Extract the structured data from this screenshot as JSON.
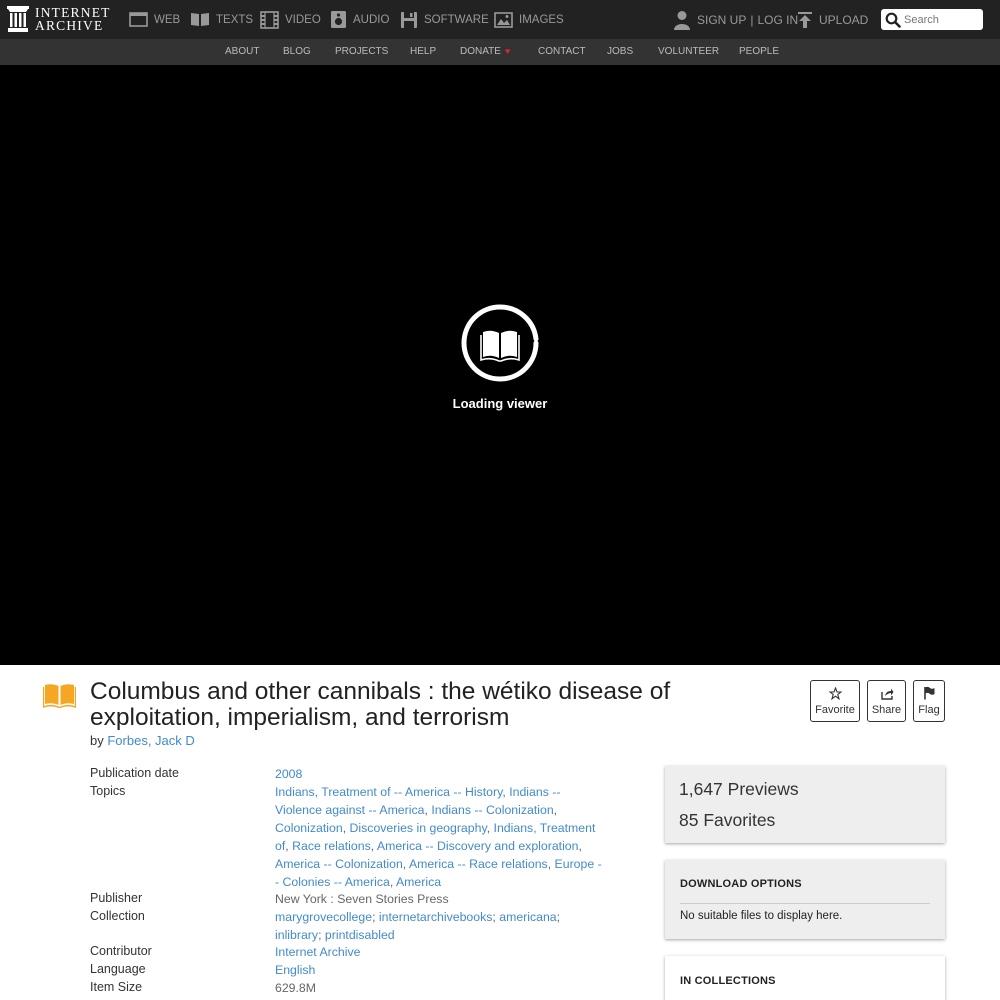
{
  "top_nav": {
    "logo_line1": "INTERNET",
    "logo_line2": "ARCHIVE",
    "items": [
      {
        "label": "WEB",
        "icon": "web-icon"
      },
      {
        "label": "TEXTS",
        "icon": "texts-icon"
      },
      {
        "label": "VIDEO",
        "icon": "video-icon"
      },
      {
        "label": "AUDIO",
        "icon": "audio-icon"
      },
      {
        "label": "SOFTWARE",
        "icon": "software-icon"
      },
      {
        "label": "IMAGES",
        "icon": "images-icon"
      }
    ],
    "sign_up": "SIGN UP",
    "separator": "|",
    "log_in": "LOG IN",
    "upload": "UPLOAD",
    "search_placeholder": "Search"
  },
  "sub_nav": {
    "items": [
      "ABOUT",
      "BLOG",
      "PROJECTS",
      "HELP",
      "DONATE",
      "CONTACT",
      "JOBS",
      "VOLUNTEER",
      "PEOPLE"
    ],
    "heart_icon": "♥"
  },
  "viewer": {
    "loading_text": "Loading viewer",
    "icon": "book-icon"
  },
  "item": {
    "title": "Columbus and other cannibals : the wétiko disease of exploitation, imperialism, and terrorism",
    "by_label": "by",
    "author": "Forbes, Jack D",
    "actions": {
      "favorite": "Favorite",
      "share": "Share",
      "flag": "Flag"
    }
  },
  "metadata": {
    "publication_date": {
      "label": "Publication date",
      "value": "2008"
    },
    "topics": {
      "label": "Topics",
      "values": [
        "Indians, Treatment of -- America -- History",
        "Indians -- Violence against -- America",
        "Indians -- Colonization",
        "Colonization",
        "Discoveries in geography",
        "Indians, Treatment of",
        "Race relations",
        "America -- Discovery and exploration",
        "America -- Colonization",
        "America -- Race relations",
        "Europe -- Colonies -- America",
        "America"
      ]
    },
    "publisher": {
      "label": "Publisher",
      "value": "New York : Seven Stories Press"
    },
    "collection": {
      "label": "Collection",
      "values": [
        "marygrovecollege",
        "internetarchivebooks",
        "americana",
        "inlibrary",
        "printdisabled"
      ]
    },
    "contributor": {
      "label": "Contributor",
      "value": "Internet Archive"
    },
    "language": {
      "label": "Language",
      "value": "English"
    },
    "item_size": {
      "label": "Item Size",
      "value": "629.8M"
    }
  },
  "stats": {
    "previews_count": "1,647",
    "previews_label": "Previews",
    "favorites_count": "85",
    "favorites_label": "Favorites"
  },
  "download": {
    "heading": "DOWNLOAD OPTIONS",
    "message": "No suitable files to display here."
  },
  "collections_box": {
    "heading": "IN COLLECTIONS"
  },
  "colors": {
    "link": "#428bca",
    "nav_bg": "#222222",
    "subnav_bg": "#333333",
    "texts_icon": "#f5a623",
    "heart": "#e0262b"
  }
}
